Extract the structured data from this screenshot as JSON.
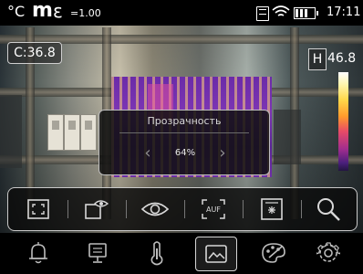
{
  "status_bar": {
    "units": "°C",
    "mode": "m",
    "emissivity_symbol": "ε",
    "emissivity_value": "=1.00",
    "time": "17:11",
    "battery_level": 0.8
  },
  "measurements": {
    "center": "C:36.8",
    "high_label": "H",
    "high_value": "46.8"
  },
  "popup": {
    "title": "Прозрачность",
    "value": "64%",
    "prev_symbol": "‹",
    "next_symbol": "›"
  },
  "toolbar": {
    "items": [
      {
        "icon": "fullscreen-frame-icon"
      },
      {
        "icon": "picture-in-picture-icon"
      },
      {
        "icon": "eye-icon"
      },
      {
        "icon": "auto-focus-icon",
        "label": "AUF"
      },
      {
        "icon": "center-spot-icon"
      },
      {
        "icon": "search-icon"
      }
    ]
  },
  "bottom_nav": {
    "items": [
      {
        "icon": "bell-icon"
      },
      {
        "icon": "monitor-icon"
      },
      {
        "icon": "thermometer-icon"
      },
      {
        "icon": "image-icon",
        "active": true
      },
      {
        "icon": "palette-icon"
      },
      {
        "icon": "gear-icon"
      }
    ]
  },
  "colors": {
    "thermal_high": "#ffffff",
    "thermal_low": "#231540",
    "ui_stroke": "#d8d8d8"
  }
}
